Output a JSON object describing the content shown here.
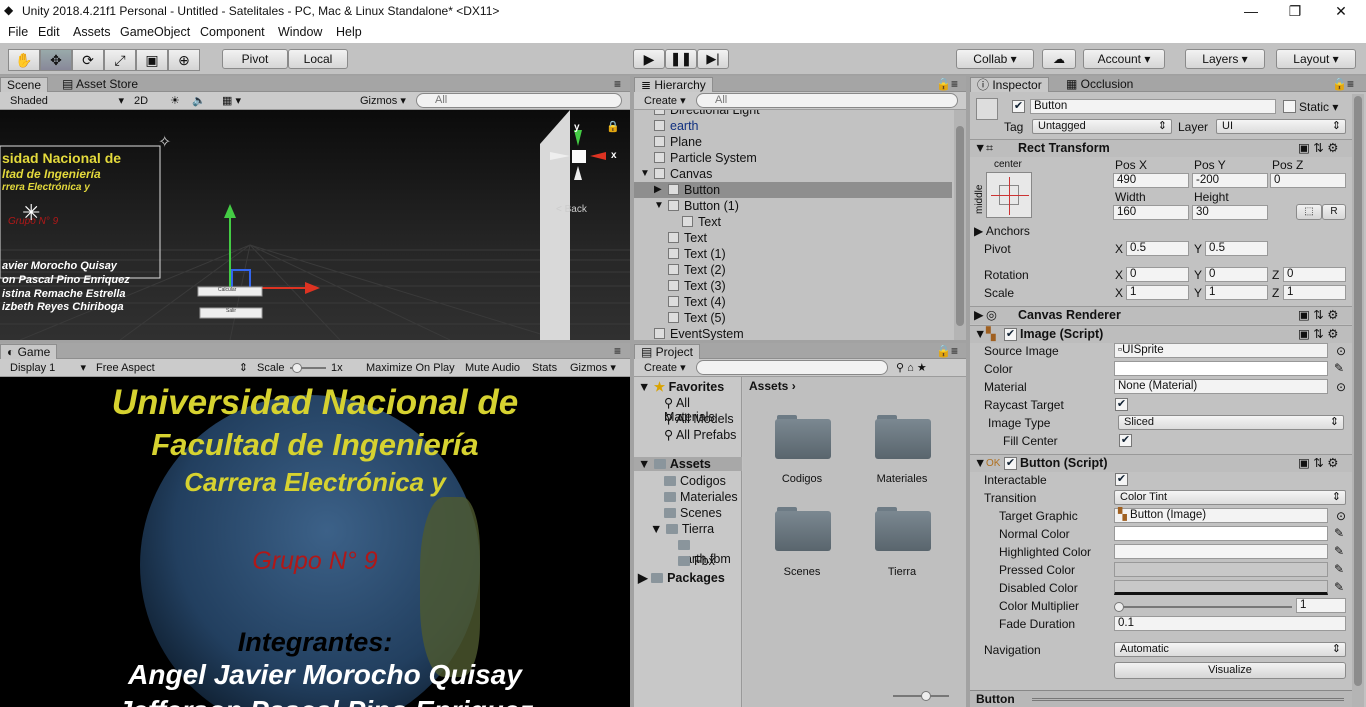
{
  "window": {
    "title": "Unity 2018.4.21f1 Personal - Untitled - Satelitales - PC, Mac & Linux Standalone* <DX11>",
    "minimize": "—",
    "restore": "❐",
    "close": "✕"
  },
  "menu": [
    "File",
    "Edit",
    "Assets",
    "GameObject",
    "Component",
    "Window",
    "Help"
  ],
  "toolbar": {
    "pivot": "Pivot",
    "local": "Local",
    "collab": "Collab",
    "account": "Account",
    "layers": "Layers",
    "layout": "Layout"
  },
  "scene": {
    "tab_scene": "Scene",
    "tab_asset_store": "Asset Store",
    "shaded": "Shaded",
    "mode2d": "2D",
    "gizmos": "Gizmos",
    "search_placeholder": "All",
    "overlay_lines": [
      "sidad Nacional de",
      "ltad de Ingeniería",
      "rrera Electrónica y",
      "Grupo N° 9",
      "avier Morocho Quisay",
      "on Pascal Pino Enriquez",
      "istina Remache Estrella",
      "izbeth Reyes Chiriboga"
    ],
    "button_labels": [
      "Calcular",
      "Salir"
    ],
    "axis_x": "x",
    "axis_y": "y",
    "back_label": "Back"
  },
  "game": {
    "tab": "Game",
    "display": "Display 1",
    "aspect": "Free Aspect",
    "scale_label": "Scale",
    "scale_value": "1x",
    "maximize": "Maximize On Play",
    "mute": "Mute Audio",
    "stats": "Stats",
    "gizmos": "Gizmos",
    "line1": "Universidad Nacional de",
    "line2": "Facultad de Ingeniería",
    "line3": "Carrera Electrónica y",
    "group": "Grupo N° 9",
    "members_title": "Integrantes:",
    "member1": "Angel Javier Morocho Quisay",
    "member2": "Jefferson Pascal Pino Enriquez"
  },
  "hierarchy": {
    "tab": "Hierarchy",
    "create": "Create",
    "search_placeholder": "All",
    "items": [
      {
        "label": "Directional Light",
        "indent": 0,
        "arrow": ""
      },
      {
        "label": "earth",
        "indent": 0,
        "arrow": ""
      },
      {
        "label": "Plane",
        "indent": 0,
        "arrow": ""
      },
      {
        "label": "Particle System",
        "indent": 0,
        "arrow": ""
      },
      {
        "label": "Canvas",
        "indent": 0,
        "arrow": "▼"
      },
      {
        "label": "Button",
        "indent": 1,
        "arrow": "▶"
      },
      {
        "label": "Button (1)",
        "indent": 1,
        "arrow": "▼"
      },
      {
        "label": "Text",
        "indent": 2,
        "arrow": ""
      },
      {
        "label": "Text",
        "indent": 1,
        "arrow": ""
      },
      {
        "label": "Text (1)",
        "indent": 1,
        "arrow": ""
      },
      {
        "label": "Text (2)",
        "indent": 1,
        "arrow": ""
      },
      {
        "label": "Text (3)",
        "indent": 1,
        "arrow": ""
      },
      {
        "label": "Text (4)",
        "indent": 1,
        "arrow": ""
      },
      {
        "label": "Text (5)",
        "indent": 1,
        "arrow": ""
      },
      {
        "label": "EventSystem",
        "indent": 0,
        "arrow": ""
      }
    ]
  },
  "project": {
    "tab": "Project",
    "create": "Create",
    "favorites": "Favorites",
    "fav_items": [
      "All Materials",
      "All Models",
      "All Prefabs"
    ],
    "assets": "Assets",
    "asset_items": [
      "Codigos",
      "Materiales",
      "Scenes",
      "Tierra"
    ],
    "tierra_children": [
      "earth.fbm",
      "Fbx"
    ],
    "packages": "Packages",
    "breadcrumb": "Assets",
    "folders": [
      "Codigos",
      "Materiales",
      "Scenes",
      "Tierra"
    ]
  },
  "inspector": {
    "tab": "Inspector",
    "tab2": "Occlusion",
    "object_name": "Button",
    "static": "Static",
    "tag_label": "Tag",
    "tag": "Untagged",
    "layer_label": "Layer",
    "layer": "UI",
    "rect": {
      "title": "Rect Transform",
      "anchor_h": "center",
      "anchor_v": "middle",
      "posx_label": "Pos X",
      "posy_label": "Pos Y",
      "posz_label": "Pos Z",
      "posx": "490",
      "posy": "-200",
      "posz": "0",
      "width_label": "Width",
      "height_label": "Height",
      "width": "160",
      "height": "30",
      "anchors": "Anchors",
      "pivot": "Pivot",
      "pivot_x": "0.5",
      "pivot_y": "0.5",
      "rotation": "Rotation",
      "rot_x": "0",
      "rot_y": "0",
      "rot_z": "0",
      "scale": "Scale",
      "scale_x": "1",
      "scale_y": "1",
      "scale_z": "1",
      "r_btn": "R"
    },
    "canvas_renderer": "Canvas Renderer",
    "image": {
      "title": "Image (Script)",
      "source_label": "Source Image",
      "source": "UISprite",
      "color_label": "Color",
      "material_label": "Material",
      "material": "None (Material)",
      "raycast_label": "Raycast Target",
      "type_label": "Image Type",
      "type": "Sliced",
      "fill_label": "Fill Center"
    },
    "button": {
      "title": "Button (Script)",
      "interactable_label": "Interactable",
      "transition_label": "Transition",
      "transition": "Color Tint",
      "target_label": "Target Graphic",
      "target": "Button (Image)",
      "normal_label": "Normal Color",
      "highlighted_label": "Highlighted Color",
      "pressed_label": "Pressed Color",
      "disabled_label": "Disabled Color",
      "multiplier_label": "Color Multiplier",
      "multiplier": "1",
      "fade_label": "Fade Duration",
      "fade": "0.1",
      "navigation_label": "Navigation",
      "navigation": "Automatic",
      "visualize": "Visualize"
    },
    "footer": "Button"
  },
  "colors": {
    "game_text": "#d6d230",
    "group_text": "#b01818",
    "accent": "#3d6fb5"
  }
}
